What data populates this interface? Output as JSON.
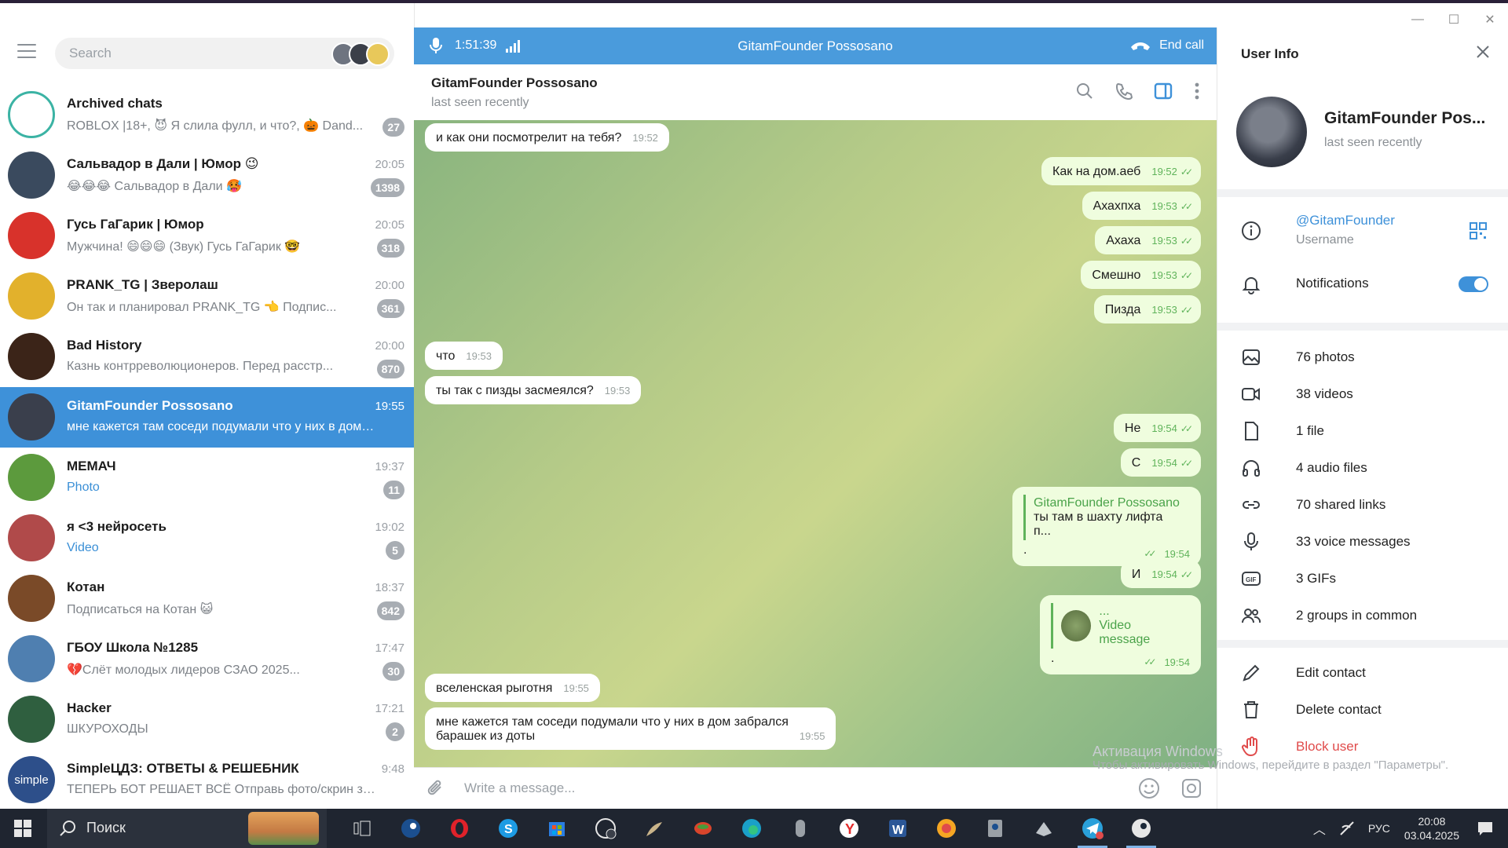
{
  "window": {
    "controls": [
      "—",
      "☐",
      "✕"
    ]
  },
  "left": {
    "search_placeholder": "Search",
    "chats": [
      {
        "name": "Archived chats",
        "time": "",
        "preview": "ROBLOX |18+, 😈 Я слила фулл, и что?, 🎃 Dand...",
        "badge": "27",
        "avatar_color": "#ffffff"
      },
      {
        "name": "Сальвадор в Дали | Юмор 😉",
        "time": "20:05",
        "preview": "😂😂😂 Сальвадор в Дали 🥵",
        "badge": "1398",
        "avatar_color": "#3a4a5e"
      },
      {
        "name": "Гусь ГаГарик | Юмор",
        "time": "20:05",
        "preview": "Мужчина! 😄😄😄 (Звук)  Гусь ГаГарик 🤓",
        "badge": "318",
        "avatar_color": "#d8322b"
      },
      {
        "name": "PRANK_TG | Зверолаш",
        "time": "20:00",
        "preview": "Он так и планировал  PRANK_TG 👈 Подпис...",
        "badge": "361",
        "avatar_color": "#e2b12c"
      },
      {
        "name": "Bad History",
        "time": "20:00",
        "preview": "Казнь контрреволюционеров. Перед расстр...",
        "badge": "870",
        "avatar_color": "#3b2418"
      },
      {
        "name": "GitamFounder Possosano",
        "time": "19:55",
        "preview": "мне кажется там соседи подумали что у них в дом за...",
        "badge": "",
        "avatar_color": "#3a3f4c"
      },
      {
        "name": "МЕМАЧ",
        "time": "19:37",
        "preview": "Photo",
        "badge": "11",
        "avatar_color": "#5c9a3d"
      },
      {
        "name": "я <3 нейросеть",
        "time": "19:02",
        "preview": "Video",
        "badge": "5",
        "avatar_color": "#b04a4a"
      },
      {
        "name": "Котан",
        "time": "18:37",
        "preview": "Подписаться на Котан 😺",
        "badge": "842",
        "avatar_color": "#7a4a28"
      },
      {
        "name": "ГБОУ Школа №1285",
        "time": "17:47",
        "preview": "💔Слёт молодых лидеров СЗАО 2025...",
        "badge": "30",
        "avatar_color": "#4f7fb0"
      },
      {
        "name": "Hacker",
        "time": "17:21",
        "preview": "ШКУРОХОДЫ",
        "badge": "2",
        "avatar_color": "#2f5f3f"
      },
      {
        "name": "SimpleЦДЗ: ОТВЕТЫ & РЕШЕБНИК",
        "time": "9:48",
        "preview": "ТЕПЕРЬ БОТ РЕШАЕТ ВСЁ  Отправь фото/скрин за...",
        "badge": "",
        "avatar_color": "#2d4f8a",
        "avatar_text": "simple"
      }
    ]
  },
  "call": {
    "timer": "1:51:39",
    "name": "GitamFounder Possosano",
    "end_label": "End call"
  },
  "chat": {
    "title": "GitamFounder Possosano",
    "status": "last seen recently"
  },
  "messages": [
    {
      "dir": "in",
      "text": "и как они посмотрелит на тебя?",
      "time": "19:52"
    },
    {
      "dir": "out",
      "text": "Как на дом.аеб",
      "time": "19:52"
    },
    {
      "dir": "out",
      "text": "Ахахпха",
      "time": "19:53"
    },
    {
      "dir": "out",
      "text": "Ахаха",
      "time": "19:53"
    },
    {
      "dir": "out",
      "text": "Смешно",
      "time": "19:53"
    },
    {
      "dir": "out",
      "text": "Пизда",
      "time": "19:53"
    },
    {
      "dir": "in",
      "text": "что",
      "time": "19:53"
    },
    {
      "dir": "in",
      "text": "ты так с пизды засмеялся?",
      "time": "19:53"
    },
    {
      "dir": "out",
      "text": "Не",
      "time": "19:54"
    },
    {
      "dir": "out",
      "text": "С",
      "time": "19:54"
    },
    {
      "dir": "out",
      "reply_name": "GitamFounder Possosano",
      "reply_text": "ты там в шахту лифта п...",
      "text": ".",
      "time": "19:54"
    },
    {
      "dir": "out",
      "text": "И",
      "time": "19:54"
    },
    {
      "dir": "out",
      "reply_name": "...",
      "reply_text": "Video message",
      "text": ".",
      "time": "19:54"
    },
    {
      "dir": "in",
      "text": "вселенская рыготня",
      "time": "19:55"
    },
    {
      "dir": "in",
      "text": "мне кажется там соседи подумали что у них в дом забрался\nбарашек из доты",
      "time": "19:55"
    }
  ],
  "composer": {
    "placeholder": "Write a message..."
  },
  "info": {
    "header": "User Info",
    "name": "GitamFounder Pos...",
    "status": "last seen recently",
    "username": "@GitamFounder",
    "username_label": "Username",
    "notifications_label": "Notifications",
    "notifications_on": true,
    "media": [
      "76 photos",
      "38 videos",
      "1 file",
      "4 audio files",
      "70 shared links",
      "33 voice messages",
      "3 GIFs",
      "2 groups in common"
    ],
    "actions": [
      "Edit contact",
      "Delete contact",
      "Block user"
    ],
    "accent": "#3e91d9",
    "danger": "#e04b4b"
  },
  "watermark": {
    "line1": "Активация Windows",
    "line2": "Чтобы активировать Windows, перейдите в раздел \"Параметры\"."
  },
  "taskbar": {
    "search_label": "Поиск",
    "lang": "РУС",
    "time": "20:08",
    "date": "03.04.2025"
  }
}
